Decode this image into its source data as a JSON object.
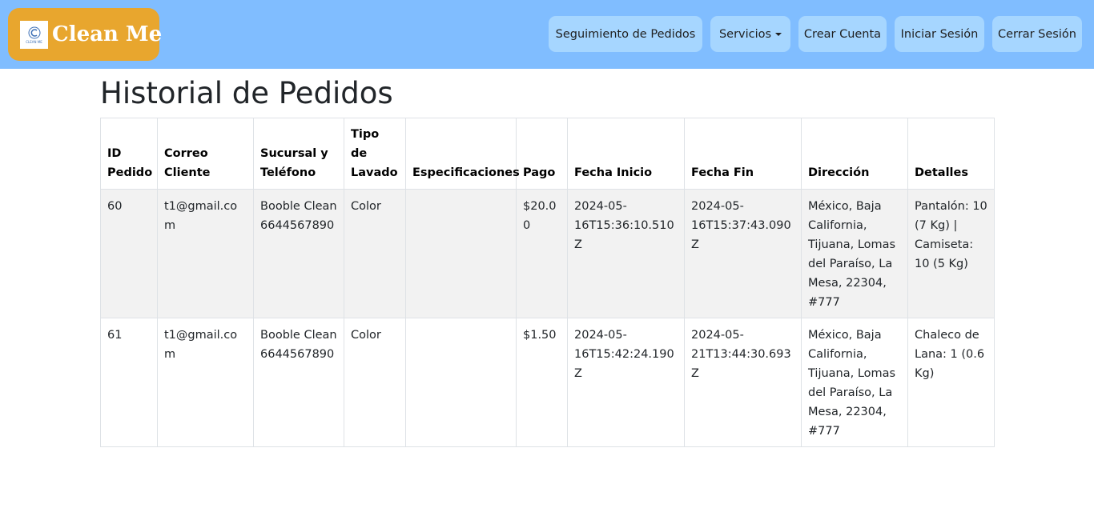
{
  "nav": {
    "brand_name": "Clean Me",
    "logo_text": "CLEAN ME",
    "buttons": [
      {
        "label": "Seguimiento de Pedidos"
      },
      {
        "label": "Servicios"
      },
      {
        "label": "Crear Cuenta"
      },
      {
        "label": "Iniciar Sesión"
      },
      {
        "label": "Cerrar Sesión"
      }
    ]
  },
  "page": {
    "title": "Historial de Pedidos"
  },
  "table": {
    "headers": [
      "ID Pedido",
      "Correo Cliente",
      "Sucursal y Teléfono",
      "Tipo de Lavado",
      "Especificaciones",
      "Pago",
      "Fecha Inicio",
      "Fecha Fin",
      "Dirección",
      "Detalles"
    ],
    "rows": [
      {
        "id": "60",
        "email": "t1@gmail.com",
        "sucursal": "Booble Clean 6644567890",
        "tipo": "Color",
        "especificaciones": "",
        "pago": "$20.00",
        "fecha_inicio": "2024-05-16T15:36:10.510Z",
        "fecha_fin": "2024-05-16T15:37:43.090Z",
        "direccion": "México, Baja California, Tijuana, Lomas del Paraíso, La Mesa, 22304, #777",
        "detalles": "Pantalón: 10 (7 Kg) | Camiseta: 10 (5 Kg)"
      },
      {
        "id": "61",
        "email": "t1@gmail.com",
        "sucursal": "Booble Clean 6644567890",
        "tipo": "Color",
        "especificaciones": "",
        "pago": "$1.50",
        "fecha_inicio": "2024-05-16T15:42:24.190Z",
        "fecha_fin": "2024-05-21T13:44:30.693Z",
        "direccion": "México, Baja California, Tijuana, Lomas del Paraíso, La Mesa, 22304, #777",
        "detalles": "Chaleco de Lana: 1 (0.6 Kg)"
      }
    ]
  },
  "colors": {
    "navbar": "#80bdff",
    "brand": "#e8a62e",
    "nav_button": "#a6d6ff",
    "row_stripe": "#f2f2f2"
  }
}
